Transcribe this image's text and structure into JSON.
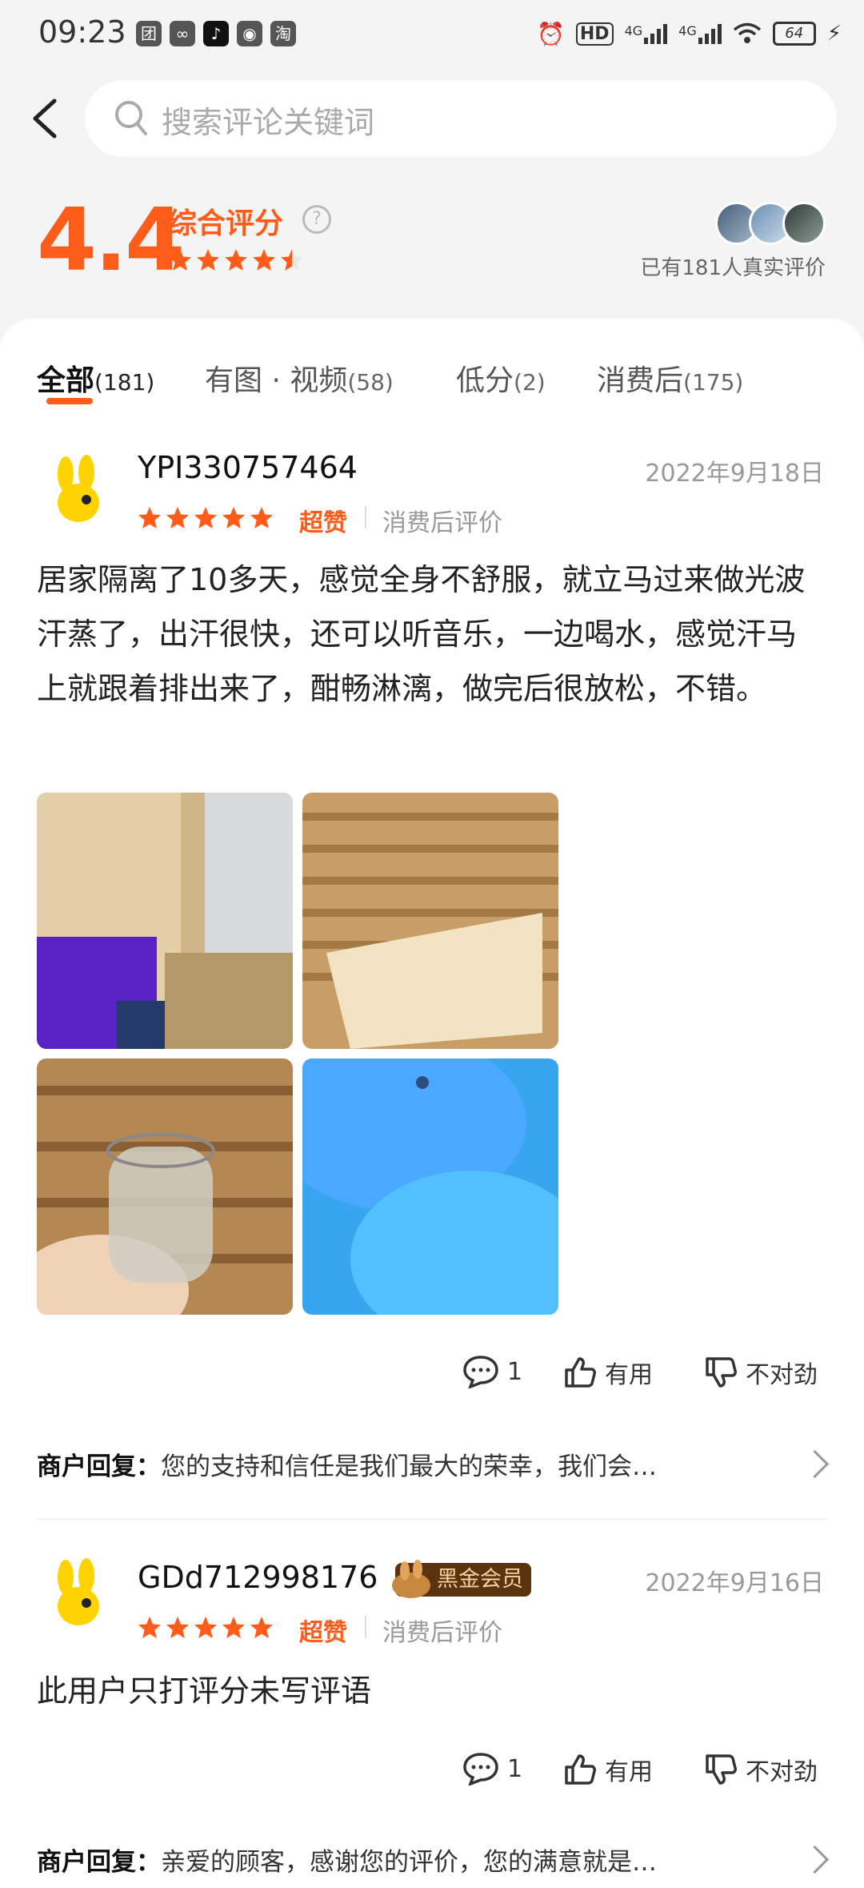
{
  "status_bar": {
    "time": "09:23",
    "app_icons": [
      "团",
      "",
      "",
      "",
      "淘"
    ],
    "hd": "HD",
    "net1": "4G",
    "net2": "4G",
    "battery": "64"
  },
  "search": {
    "placeholder": "搜索评论关键词"
  },
  "summary": {
    "score": "4.4",
    "score_label": "综合评分",
    "stars": 4.5,
    "real_reviews": "已有181人真实评价"
  },
  "tabs": [
    {
      "label": "全部",
      "count": "(181)",
      "active": true
    },
    {
      "label": "有图 · 视频",
      "count": "(58)",
      "active": false
    },
    {
      "label": "低分",
      "count": "(2)",
      "active": false
    },
    {
      "label": "消费后",
      "count": "(175)",
      "active": false
    }
  ],
  "reviews": [
    {
      "username": "YPI330757464",
      "date": "2022年9月18日",
      "stars": 5,
      "rating_word": "超赞",
      "tag": "消费后评价",
      "text": "居家隔离了10多天，感觉全身不舒服，就立马过来做光波汗蒸了，出汗很快，还可以听音乐，一边喝水，感觉汗马上就跟着排出来了，酣畅淋漓，做完后很放松，不错。",
      "comments": "1",
      "useful": "有用",
      "not_right": "不对劲",
      "reply_label": "商户回复：",
      "reply": "您的支持和信任是我们最大的荣幸，我们会…"
    },
    {
      "username": "GDd712998176",
      "badge": "黑金会员",
      "date": "2022年9月16日",
      "stars": 5,
      "rating_word": "超赞",
      "tag": "消费后评价",
      "text": "此用户只打评分未写评语",
      "comments": "1",
      "useful": "有用",
      "not_right": "不对劲",
      "reply_label": "商户回复：",
      "reply": "亲爱的顾客，感谢您的评价，您的满意就是…"
    }
  ],
  "colors": {
    "accent": "#ff5c1a",
    "bg": "#f4f4f4"
  }
}
